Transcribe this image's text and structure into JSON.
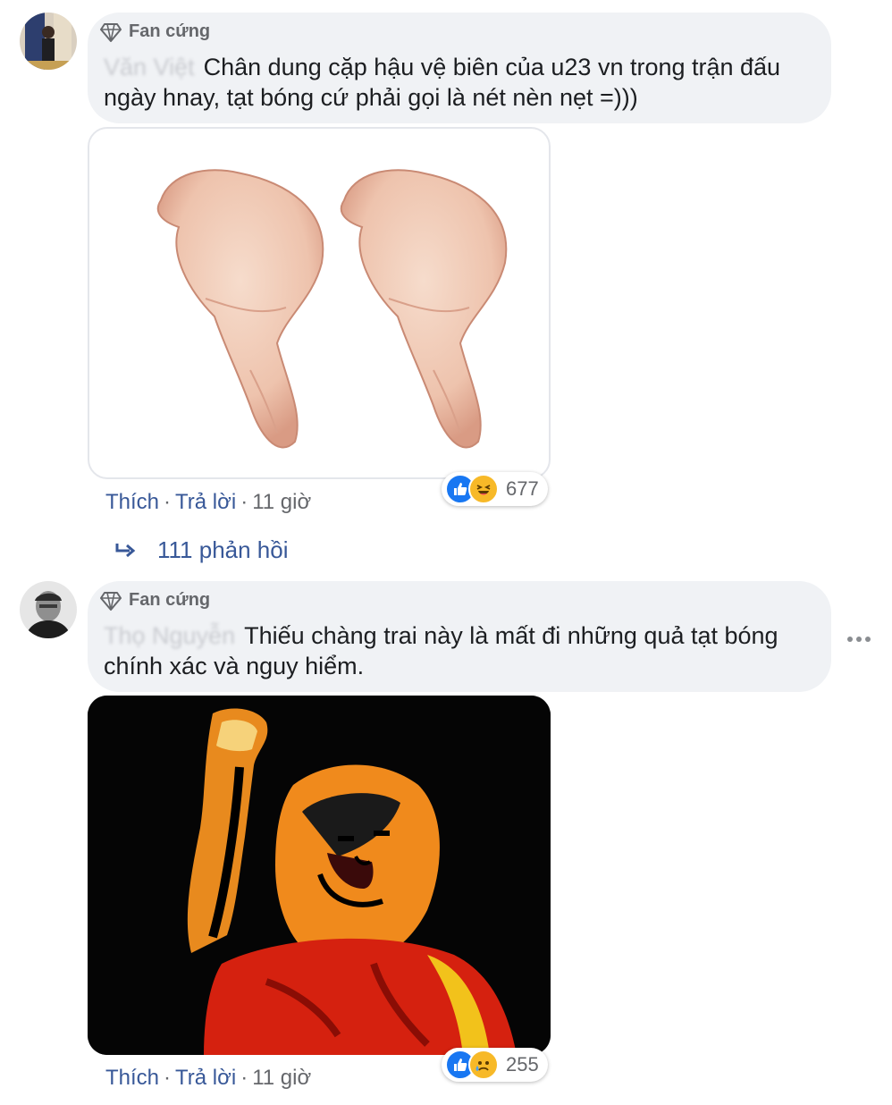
{
  "comments": [
    {
      "badge": "Fan cứng",
      "author_blurred": "Văn Việt",
      "text_line1": "Chân dung cặp hậu vệ biên của u23 vn trong trận đấu",
      "text_line2": "ngày hnay, tạt bóng cứ phải gọi là nét nèn nẹt =)))",
      "image": "chicken-wings-photo",
      "actions": {
        "like": "Thích",
        "reply": "Trả lời",
        "sep": "·",
        "time": "11 giờ"
      },
      "reactions": {
        "icons": [
          "like-icon",
          "haha-icon"
        ],
        "count": "677"
      }
    },
    {
      "badge": "Fan cứng",
      "author_blurred": "Thọ Nguyễn",
      "text_line1": "Thiếu chàng trai này là mất đi những quả tạt bóng",
      "text_line2": "chính xác và nguy hiểm.",
      "image": "player-poster-art",
      "actions": {
        "like": "Thích",
        "reply": "Trả lời",
        "sep": "·",
        "time": "11 giờ"
      },
      "reactions": {
        "icons": [
          "like-icon",
          "sad-icon"
        ],
        "count": "255"
      }
    }
  ],
  "replies": {
    "icon": "reply-arrow-icon",
    "label": "111 phản hồi"
  },
  "colors": {
    "bubble": "#f0f2f5",
    "link": "#385898",
    "meta": "#65676b",
    "like_blue": "#1877f2",
    "haha_yellow": "#f7b928"
  }
}
